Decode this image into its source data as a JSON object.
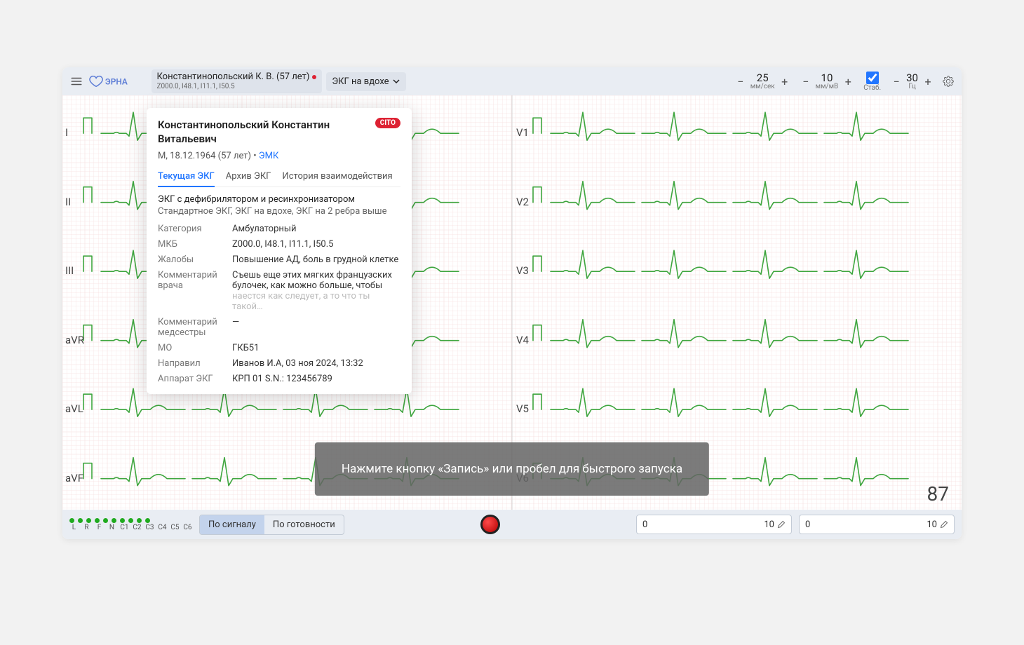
{
  "header": {
    "patient_short": "Константинопольский К. В. (57 лет)",
    "patient_codes": "Z000.0, I48.1, I11.1, I50.5",
    "mode_label": "ЭКГ на вдохе",
    "speed": {
      "value": "25",
      "unit": "мм/сек"
    },
    "gain": {
      "value": "10",
      "unit": "мм/мВ"
    },
    "stab_label": "Стаб.",
    "stab_checked": true,
    "freq": {
      "value": "30",
      "unit": "Гц"
    }
  },
  "leads": [
    "I",
    "II",
    "III",
    "aVR",
    "aVL",
    "aVF",
    "V1",
    "V2",
    "V3",
    "V4",
    "V5",
    "V6"
  ],
  "hr": "87",
  "toast": "Нажмите кнопку «Запись» или пробел для быстрого запуска",
  "card": {
    "full_name": "Константинопольский Константин Витальевич",
    "cito": "CITO",
    "subline_prefix": "М, 18.12.1964 (57 лет)  •  ",
    "emr_link": "ЭМК",
    "tabs": [
      "Текущая ЭКГ",
      "Архив ЭКГ",
      "История взаимодействия"
    ],
    "active_tab": 0,
    "line1": "ЭКГ с дефибрилятором и ресинхронизатором",
    "line2": "Стандартное ЭКГ, ЭКГ на вдохе, ЭКГ на 2 ребра выше",
    "rows": [
      {
        "k": "Категория",
        "v": "Амбулаторный"
      },
      {
        "k": "МКБ",
        "v": "Z000.0, I48.1, I11.1, I50.5"
      },
      {
        "k": "Жалобы",
        "v": "Повышение АД, боль в грудной клетке"
      },
      {
        "k": "Комментарий врача",
        "v": "Съешь еще этих мягких французских булочек, как можно больше, чтобы наестся как следует, а то что ты такой…",
        "fade_tail": true
      },
      {
        "k": "Комментарий медсестры",
        "v": "—"
      },
      {
        "k": "МО",
        "v": "ГКБ51"
      },
      {
        "k": "Направил",
        "v": "Иванов И.А, 03 ноя 2024, 13:32"
      },
      {
        "k": "Аппарат ЭКГ",
        "v": "КРП 01 S.N.: 123456789"
      }
    ]
  },
  "footer": {
    "lead_indicators": [
      "L",
      "R",
      "F",
      "N",
      "C1",
      "C2",
      "C3",
      "C4",
      "C5",
      "C6"
    ],
    "segment": [
      "По сигналу",
      "По готовности"
    ],
    "segment_active": 0,
    "input1": {
      "left": "0",
      "right": "10"
    },
    "input2": {
      "left": "0",
      "right": "10"
    }
  },
  "colors": {
    "signal": "#3fa63f",
    "grid_major": "#e1e1e1",
    "grid_minor": "#f0f0f0",
    "grid_pink": "#f6dede",
    "accent": "#2176ff",
    "red": "#d23"
  }
}
